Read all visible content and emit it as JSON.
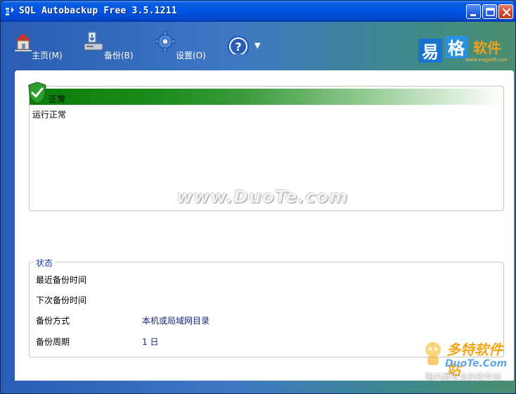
{
  "window": {
    "title": "SQL Autobackup Free 3.5.1211"
  },
  "toolbar": {
    "home_label": "主页(M)",
    "backup_label": "备份(B)",
    "settings_label": "设置(O)",
    "help_dropdown": "▼"
  },
  "brand": {
    "text_a": "易",
    "text_b": "格",
    "text_c": "软件",
    "url": "www.eagsoft.com"
  },
  "status": {
    "title": "正常",
    "message": "运行正常"
  },
  "watermark": {
    "text": "www.DuoTe.com"
  },
  "info": {
    "legend": "状态",
    "rows": [
      {
        "key": "最近备份时间",
        "value": ""
      },
      {
        "key": "下次备份时间",
        "value": ""
      },
      {
        "key": "备份方式",
        "value": "本机或局域网目录"
      },
      {
        "key": "备份周期",
        "value": "1 日"
      }
    ]
  },
  "corner": {
    "line1": "多特软件站",
    "line2": "DuoTe.Com",
    "line3": "国内最安全的软件站"
  },
  "colors": {
    "titlebar": "#0054e3",
    "status_green": "#0a7c0a",
    "legend_blue": "#1e3ea0",
    "value_blue": "#1a237e"
  }
}
